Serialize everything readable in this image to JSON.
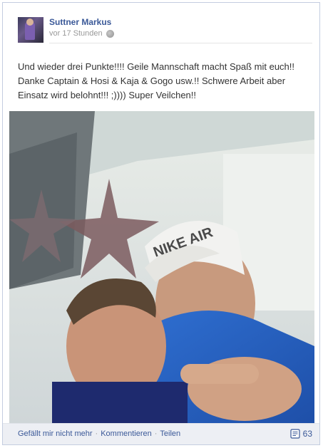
{
  "post": {
    "author": "Suttner Markus",
    "time": "vor 17 Stunden",
    "message": "Und wieder drei Punkte!!!! Geile Mannschaft macht Spaß mit euch!! Danke Captain & Hosi & Kaja & Gogo usw.!! Schwere Arbeit aber Einsatz wird belohnt!!! ;)))) Super Veilchen!!",
    "cap_text": "NIKE AIR"
  },
  "footer": {
    "unlike": "Gefällt mir nicht mehr",
    "sep1": "·",
    "comment": "Kommentieren",
    "sep2": "·",
    "share": "Teilen",
    "count": "63"
  },
  "colors": {
    "link": "#3b5998",
    "footer_bg": "#edeff4"
  }
}
